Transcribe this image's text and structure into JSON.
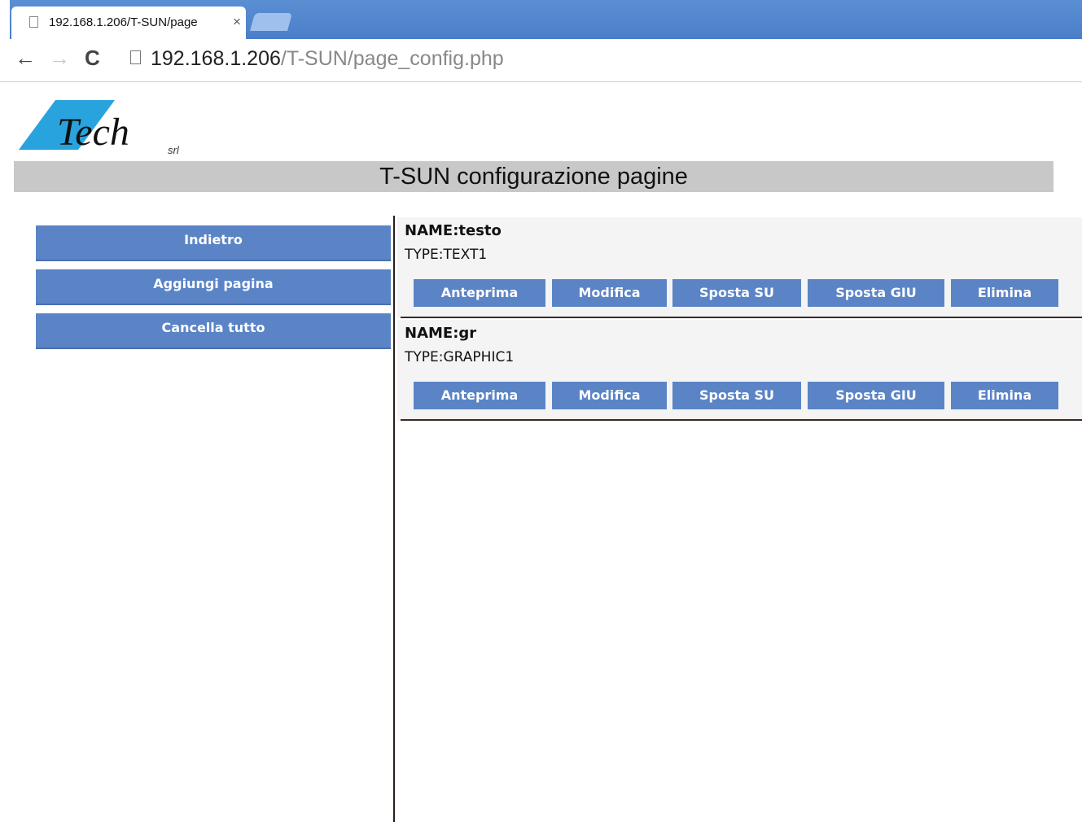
{
  "browser": {
    "tab_title": "192.168.1.206/T-SUN/page",
    "close_glyph": "×",
    "back_glyph": "←",
    "forward_glyph": "→",
    "reload_glyph": "C",
    "url_host": "192.168.1.206",
    "url_path": "/T-SUN/page_config.php"
  },
  "logo": {
    "text": "Tech",
    "suffix": "srl",
    "color": "#29a3dd"
  },
  "header": {
    "title": "T-SUN configurazione pagine"
  },
  "sidebar": {
    "buttons": [
      {
        "label": "Indietro"
      },
      {
        "label": "Aggiungi pagina"
      },
      {
        "label": "Cancella tutto"
      }
    ]
  },
  "pages": [
    {
      "name": "NAME:testo",
      "type": "TYPE:TEXT1",
      "actions": [
        "Anteprima",
        "Modifica",
        "Sposta SU",
        "Sposta GIU",
        "Elimina"
      ]
    },
    {
      "name": "NAME:gr",
      "type": "TYPE:GRAPHIC1",
      "actions": [
        "Anteprima",
        "Modifica",
        "Sposta SU",
        "Sposta GIU",
        "Elimina"
      ]
    }
  ],
  "colors": {
    "button": "#5b84c6",
    "header_bar": "#c8c8c8",
    "chrome": "#4a7ec8"
  }
}
